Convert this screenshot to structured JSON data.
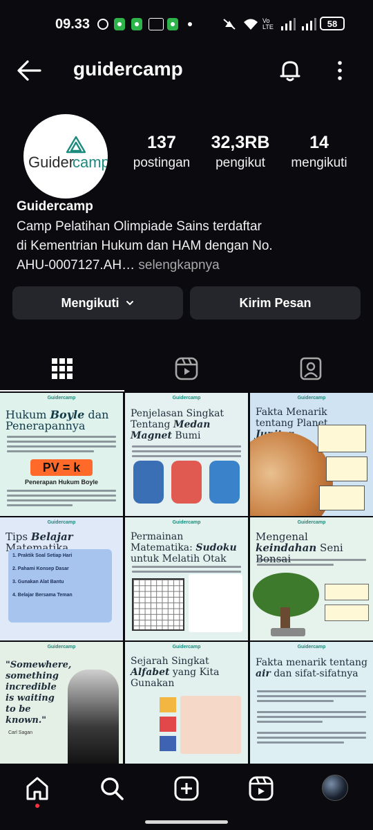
{
  "status_bar": {
    "time": "09.33",
    "battery": "58",
    "net_label": "Vo LTE"
  },
  "header": {
    "username": "guidercamp"
  },
  "profile": {
    "logo_text_dark": "Guider",
    "logo_text_accent": "camp",
    "stats": [
      {
        "value": "137",
        "label": "postingan"
      },
      {
        "value": "32,3RB",
        "label": "pengikut"
      },
      {
        "value": "14",
        "label": "mengikuti"
      }
    ],
    "name": "Guidercamp",
    "bio_lines": [
      "Camp Pelatihan Olimpiade Sains terdaftar",
      "di Kementrian Hukum dan HAM dengan No.",
      "AHU-0007127.AH…"
    ],
    "more_label": "selengkapnya"
  },
  "buttons": {
    "following": "Mengikuti",
    "message": "Kirim Pesan"
  },
  "tabs": [
    "grid-icon",
    "reels-icon",
    "tagged-icon"
  ],
  "posts": [
    {
      "title_a": "Hukum ",
      "title_b": "Boyle",
      "title_c": " dan Penerapannya",
      "bg": "#dff3ec",
      "extra": "PV = k",
      "sub": "Penerapan Hukum Boyle"
    },
    {
      "title_a": "Penjelasan Singkat Tentang ",
      "title_b": "Medan Magnet",
      "title_c": " Bumi",
      "bg": "#e4f1f0"
    },
    {
      "title_a": "Fakta Menarik tentang Planet ",
      "title_b": "Jupiter",
      "title_c": "",
      "bg": "#cfe3f2"
    },
    {
      "title_a": "Tips ",
      "title_b": "Belajar",
      "title_c": " Matematika",
      "bg": "#dfe9f8",
      "items": [
        "1. Praktik Soal Setiap Hari",
        "2. Pahami Konsep Dasar",
        "3. Gunakan Alat Bantu",
        "4. Belajar Bersama Teman"
      ]
    },
    {
      "title_a": "Permainan Matematika: ",
      "title_b": "Sudoku",
      "title_c": " untuk Melatih Otak",
      "bg": "#e3f2ee"
    },
    {
      "title_a": "Mengenal ",
      "title_b": "keindahan",
      "title_c": " Seni Bonsai",
      "bg": "#e6f2ec"
    },
    {
      "title_a": "\"Somewhere, something incredible is waiting to be known.\"",
      "title_b": "",
      "title_c": "",
      "bg": "#e4efe6",
      "sub": "Carl Sagan"
    },
    {
      "title_a": "Sejarah Singkat ",
      "title_b": "Alfabet",
      "title_c": " yang Kita Gunakan",
      "bg": "#e2f1ee"
    },
    {
      "title_a": "Fakta menarik tentang ",
      "title_b": "air",
      "title_c": " dan sifat-sifatnya",
      "bg": "#ddeff3"
    }
  ],
  "nav": [
    "home-icon",
    "search-icon",
    "create-icon",
    "reels-icon",
    "profile-avatar"
  ],
  "colors": {
    "bg": "#0b0b0f",
    "button": "#25262b",
    "accent": "#1c8a7c",
    "notif_dot": "#ff3040"
  }
}
